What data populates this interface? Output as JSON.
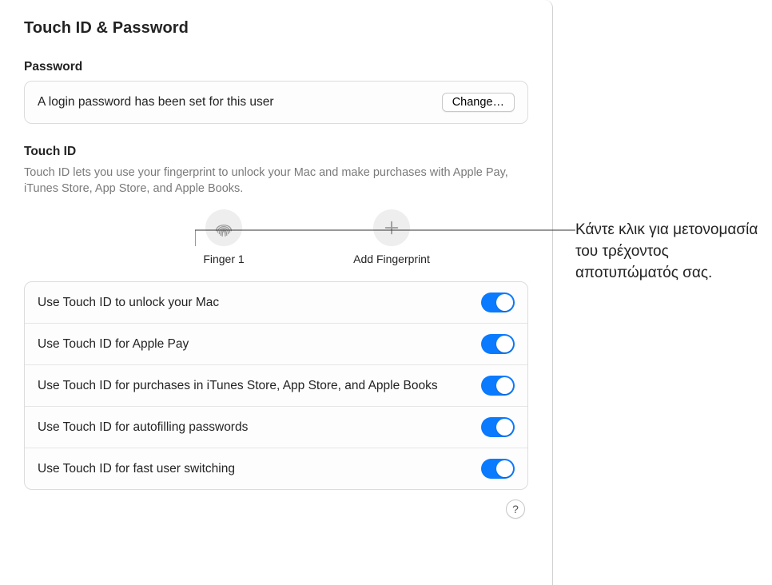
{
  "title": "Touch ID & Password",
  "password": {
    "heading": "Password",
    "status": "A login password has been set for this user",
    "change_label": "Change…"
  },
  "touchid": {
    "heading": "Touch ID",
    "description": "Touch ID lets you use your fingerprint to unlock your Mac and make purchases with Apple Pay, iTunes Store, App Store, and Apple Books.",
    "finger_label": "Finger 1",
    "add_label": "Add Fingerprint"
  },
  "options": {
    "unlock": "Use Touch ID to unlock your Mac",
    "applepay": "Use Touch ID for Apple Pay",
    "purchases": "Use Touch ID for purchases in iTunes Store, App Store, and Apple Books",
    "autofill": "Use Touch ID for autofilling passwords",
    "fastswitch": "Use Touch ID for fast user switching"
  },
  "help_glyph": "?",
  "callout": "Κάντε κλικ για μετονομασία του τρέχοντος αποτυπώματός σας."
}
